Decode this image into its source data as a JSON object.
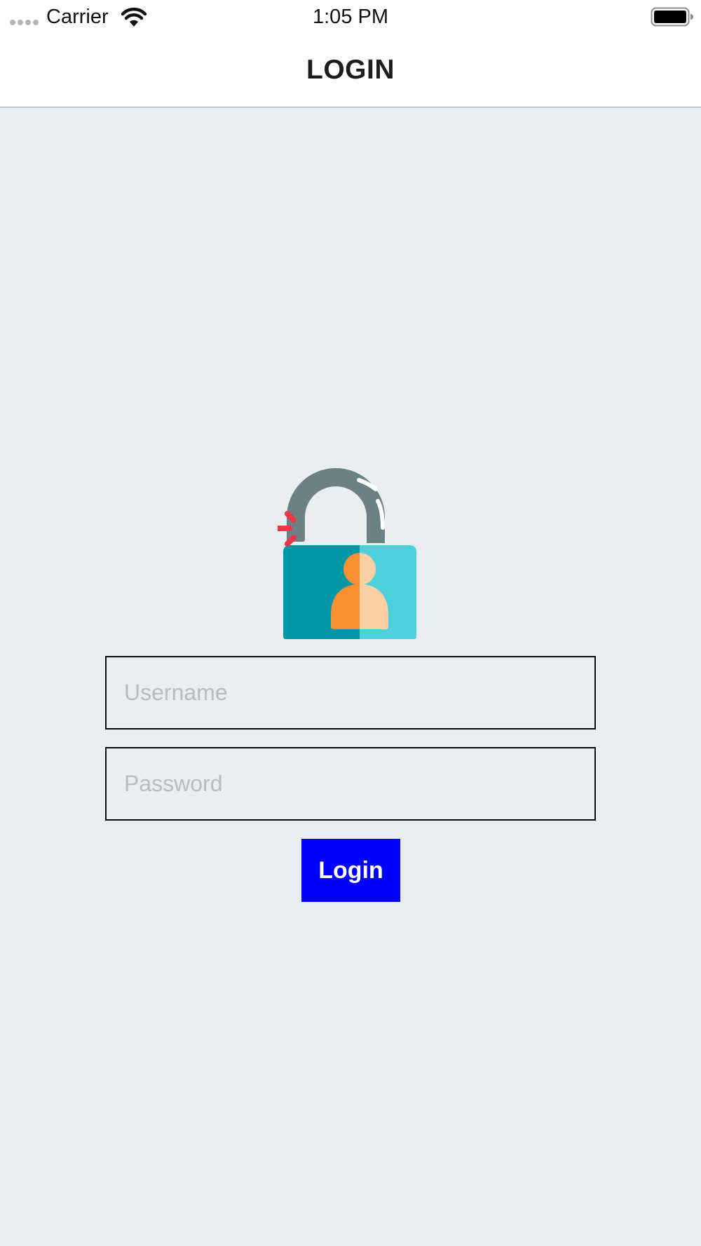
{
  "status_bar": {
    "carrier": "Carrier",
    "time": "1:05 PM",
    "icons": [
      "signal-dots-icon",
      "wifi-icon",
      "battery-icon"
    ]
  },
  "nav": {
    "title": "LOGIN"
  },
  "illustration": {
    "icon": "unlocked-padlock-user-icon",
    "colors": {
      "shackle": "#6c8186",
      "body_dark": "#0396a6",
      "body_light": "#4dd0db",
      "person_dark": "#fd8f33",
      "person_light": "#fcd0a4",
      "spark": "#e8394a"
    }
  },
  "form": {
    "username_placeholder": "Username",
    "username_value": "",
    "password_placeholder": "Password",
    "password_value": "",
    "login_label": "Login"
  },
  "colors": {
    "background": "#eaeef0",
    "button": "#0000ff",
    "button_text": "#ffffff",
    "field_border": "#0b0b0b"
  }
}
